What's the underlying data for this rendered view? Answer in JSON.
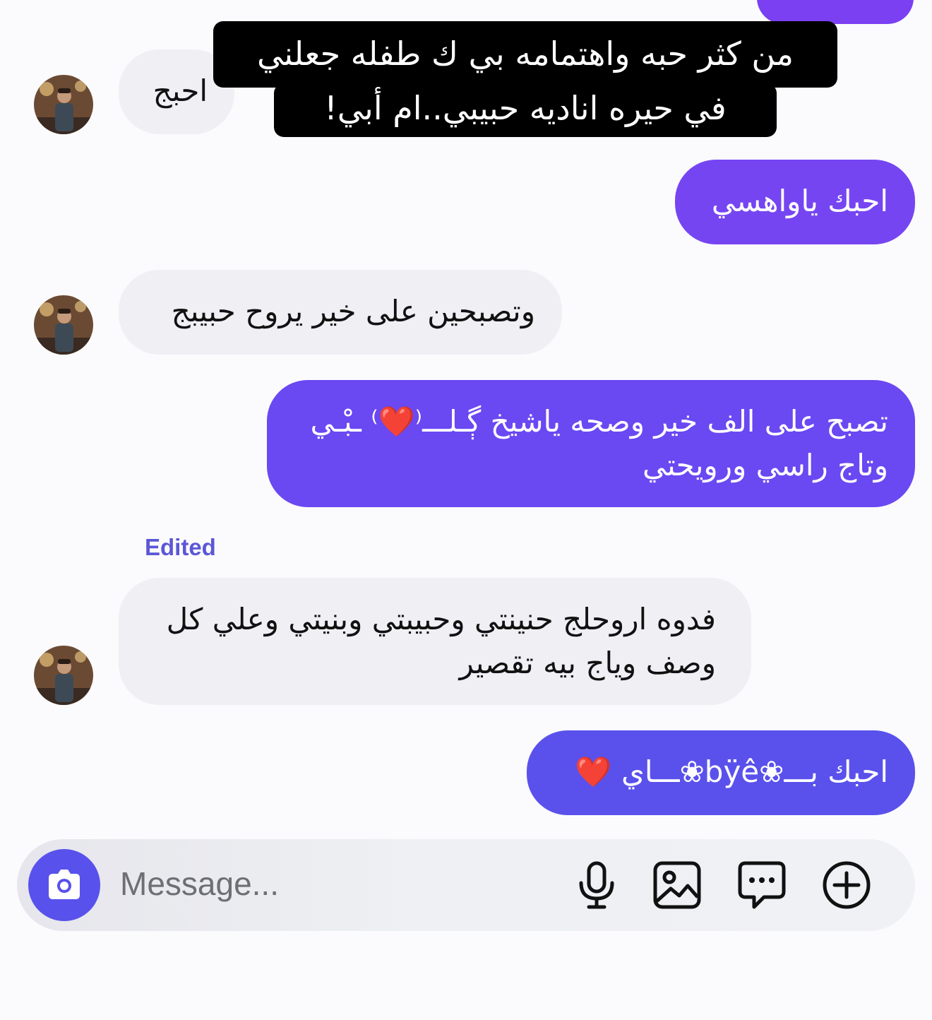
{
  "caption": {
    "line1": "من كثر حبه واهتمامه بي ك طفله جعلني",
    "line2": "في حيره اناديه حبيبي..ام أبي!"
  },
  "messages": [
    {
      "text": "احبج"
    },
    {
      "text": "احبك ياواهسي"
    },
    {
      "text": "وتصبحين على خير يروح حبيبج"
    },
    {
      "text": "تصبح على الف خير وصحه ياشيخ ڳـلـــ⁽❤️⁾ ‏ـبْـي وتاج راسي ورويحتي"
    },
    {
      "edited_label": "Edited",
      "text": "فدوه اروحلج حنينتي وحبيبتي وبنيتي وعلي كل\nوصف وياج بيه تقصير"
    },
    {
      "text": "احبك بـــ❀bÿê❀ـــاي ❤️"
    }
  ],
  "composer": {
    "placeholder": "Message...",
    "icons": [
      "camera-icon",
      "microphone-icon",
      "image-icon",
      "sticker-icon",
      "plus-icon"
    ]
  },
  "colors": {
    "outgoing_top": "#7b45f2",
    "outgoing_bottom": "#5a51ec",
    "incoming": "#efeff4",
    "accent": "#5851ec"
  }
}
